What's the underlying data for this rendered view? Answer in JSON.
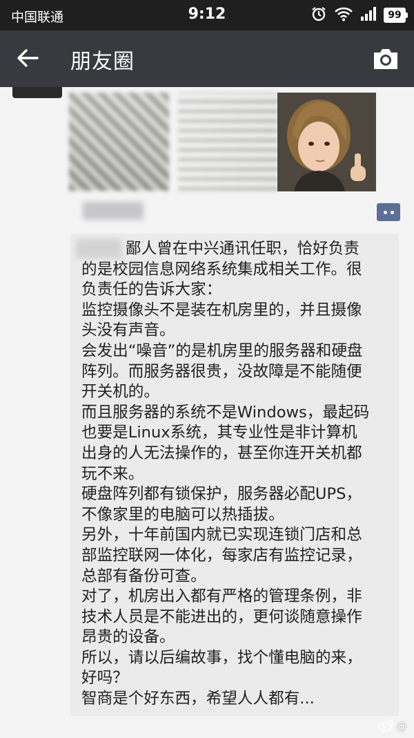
{
  "status_bar": {
    "carrier": "中国联通",
    "time": "9:12",
    "battery": "99"
  },
  "nav": {
    "title": "朋友圈"
  },
  "comment": {
    "lines": [
      "鄙人曾在中兴通讯任职，恰好负责",
      "的是校园信息网络系统集成相关工作。很",
      "负责任的告诉大家：",
      "监控摄像头不是装在机房里的，并且摄像",
      "头没有声音。",
      "会发出“噪音”的是机房里的服务器和硬盘",
      "阵列。而服务器很贵，没故障是不能随便",
      "开关机的。",
      "而且服务器的系统不是Windows，最起码",
      "也要是Linux系统，其专业性是非计算机",
      "出身的人无法操作的，甚至你连开关机都",
      "玩不来。",
      "硬盘阵列都有锁保护，服务器必配UPS，",
      "不像家里的电脑可以热插拔。",
      "另外，十年前国内就已实现连锁门店和总",
      "部监控联网一体化，每家店有监控记录，",
      "总部有备份可查。",
      "对了，机房出入都有严格的管理条例，非",
      "技术人员是不能进出的，更何谈随意操作",
      "昂贵的设备。",
      "所以，请以后编故事，找个懂电脑的来，",
      "好吗？",
      "智商是个好东西，希望人人都有..."
    ]
  },
  "colors": {
    "status_bar_bg": "#1f1f1f",
    "nav_bar_bg": "#393a3f",
    "comment_button": "#5b6f97",
    "comment_bg": "#ebebeb"
  }
}
